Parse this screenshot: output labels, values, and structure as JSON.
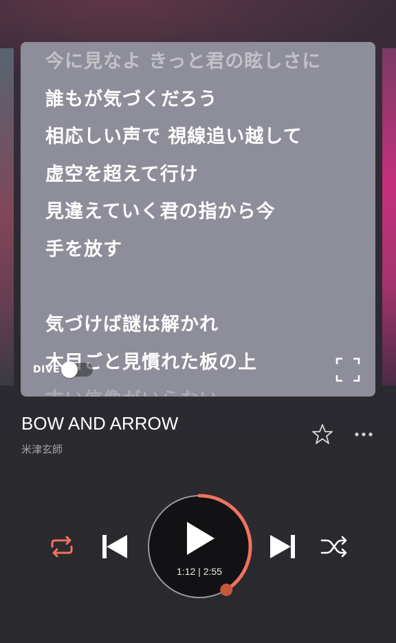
{
  "lyrics": {
    "lines": [
      {
        "text": "今に見なよ きっと君の眩しさに",
        "style": "faded-top"
      },
      {
        "text": "誰もが気づくだろう",
        "style": "normal"
      },
      {
        "text": "相応しい声で 視線追い越して",
        "style": "normal"
      },
      {
        "text": "虚空を超えて行け",
        "style": "normal"
      },
      {
        "text": "見違えていく君の指から今",
        "style": "normal"
      },
      {
        "text": "手を放す",
        "style": "normal"
      },
      {
        "text": "",
        "style": "blank"
      },
      {
        "text": "気づけば謎は解かれ",
        "style": "normal"
      },
      {
        "text": "木目ごと見慣れた板の上",
        "style": "normal"
      },
      {
        "text": "古い信像がいらない",
        "style": "faded-bottom"
      }
    ],
    "dive_label": "DIVE",
    "dive_enabled": false
  },
  "track": {
    "title": "BOW AND ARROW",
    "artist": "米津玄師",
    "favorited": false
  },
  "player": {
    "elapsed": "1:12",
    "duration": "2:55",
    "time_readout": "1:12 | 2:55",
    "progress_fraction": 0.411,
    "state": "paused",
    "repeat_on": true,
    "shuffle_on": false
  },
  "icons": {
    "repeat": "repeat-icon",
    "previous": "skip-previous-icon",
    "play": "play-icon",
    "next": "skip-next-icon",
    "shuffle": "shuffle-icon",
    "star": "star-outline-icon",
    "more": "more-horizontal-icon",
    "fullscreen": "fullscreen-icon"
  },
  "colors": {
    "accent": "#f0735e",
    "lyrics_card": "#8e8e9a",
    "background": "#2b2a30"
  }
}
